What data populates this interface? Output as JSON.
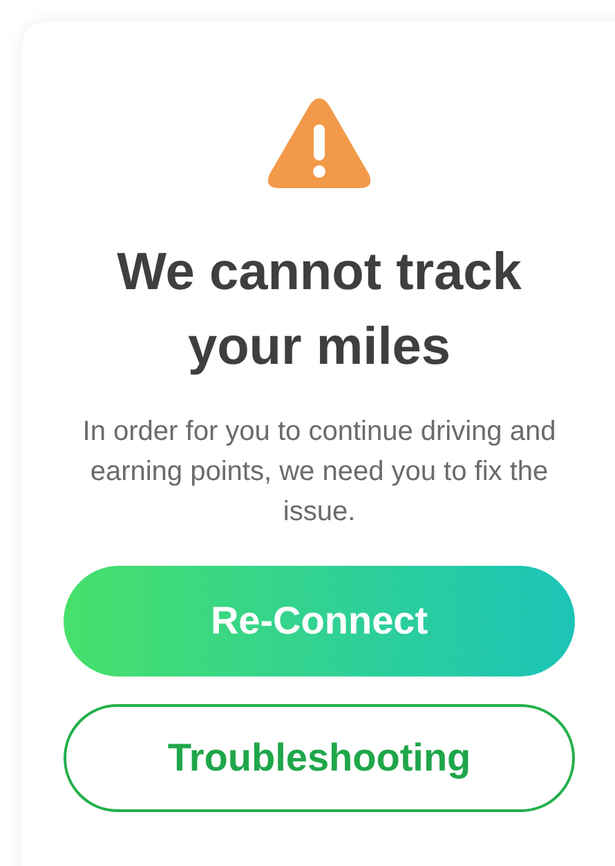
{
  "alert": {
    "title": "We cannot track your miles",
    "message": "In order for you to continue driving and earning points, we need you to fix the issue."
  },
  "buttons": [
    {
      "label": "Re-Connect",
      "kind": "primary"
    },
    {
      "label": "Troubleshooting",
      "kind": "outline"
    }
  ]
}
